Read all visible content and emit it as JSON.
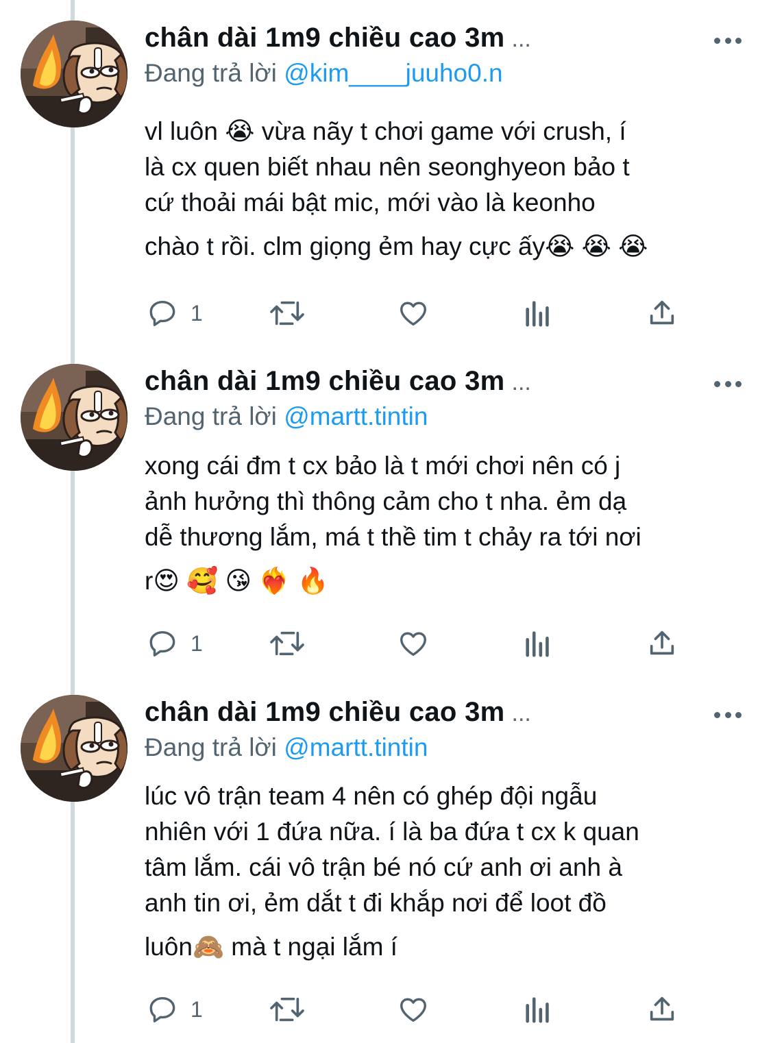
{
  "thread": {
    "tweets": [
      {
        "author_name": "chân dài 1m9 chiều cao 3m",
        "name_truncation": "...",
        "reply_prefix": "Đang trả lời",
        "reply_handle": "@kim____juuho0.n",
        "text_lines": [
          "vl luôn 😭  vừa nãy t chơi game với crush, í",
          "là cx quen biết nhau nên seonghyeon bảo t",
          "cứ thoải mái bật mic, mới vào là keonho",
          "chào t rồi. clm giọng ẻm hay cực ấy😭 😭 😭"
        ],
        "reply_count": "1"
      },
      {
        "author_name": "chân dài 1m9 chiều cao 3m",
        "name_truncation": "...",
        "reply_prefix": "Đang trả lời",
        "reply_handle": "@martt.tintin",
        "text_lines": [
          "xong cái đm t cx bảo là t mới chơi nên có j",
          "ảnh hưởng thì thông cảm cho t nha. ẻm dạ",
          "dễ thương lắm, má t thề tim t chảy ra tới nơi",
          "r😍 🥰 😘 ❤️‍🔥 🔥"
        ],
        "reply_count": "1"
      },
      {
        "author_name": "chân dài 1m9 chiều cao 3m",
        "name_truncation": "...",
        "reply_prefix": "Đang trả lời",
        "reply_handle": "@martt.tintin",
        "text_lines": [
          "lúc vô trận team 4 nên có ghép đội ngẫu",
          "nhiên với 1 đứa nữa. í là ba đứa t cx k quan",
          "tâm lắm. cái vô trận bé nó cứ anh ơi anh à",
          "anh tin ơi, ẻm dắt t đi khắp nơi để loot đồ",
          "luôn🙈  mà t ngại lắm í"
        ],
        "reply_count": "1"
      }
    ]
  },
  "icons": {
    "reply": "reply-bubble-icon",
    "retweet": "retweet-icon",
    "like": "heart-icon",
    "views": "views-bar-chart-icon",
    "share": "share-upload-icon",
    "more": "more-horizontal-icon"
  },
  "colors": {
    "text": "#0f1419",
    "secondary": "#536471",
    "link": "#1d9bf0",
    "thread_line": "#cfd9de"
  }
}
